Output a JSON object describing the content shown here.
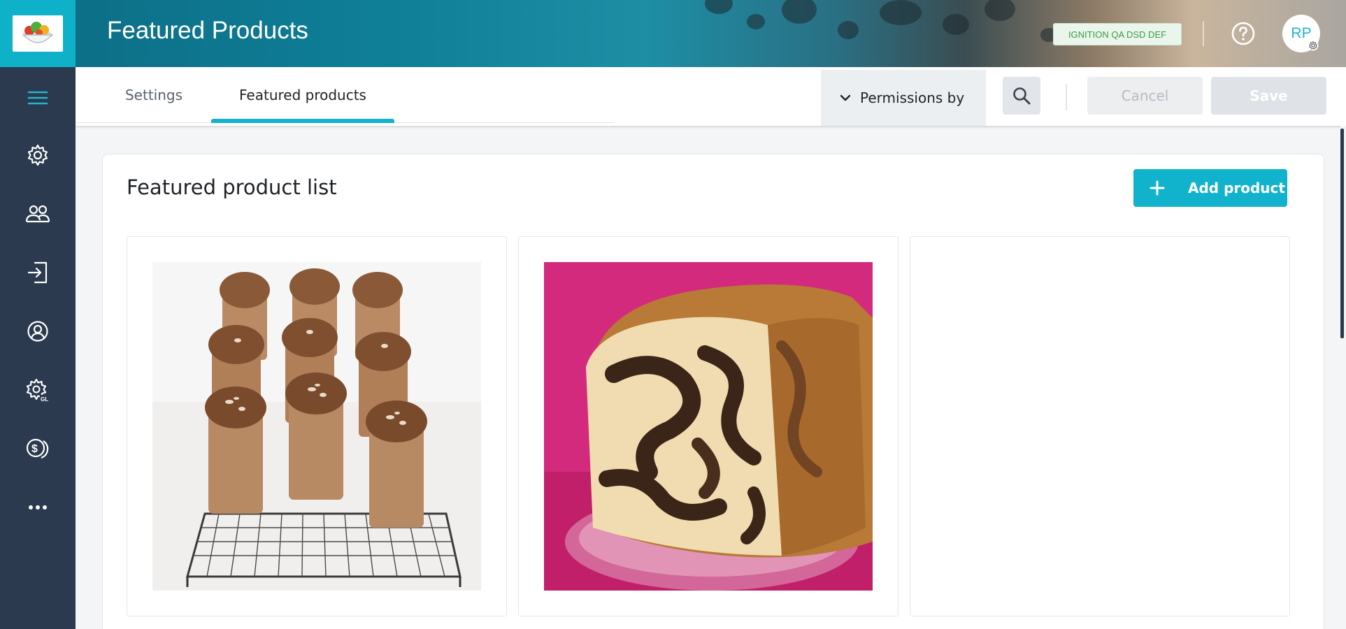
{
  "header": {
    "title": "Featured Products",
    "environment_badge": "IGNITION QA DSD DEF",
    "avatar_initials": "RP",
    "icons": [
      "help-icon",
      "avatar-settings-icon"
    ]
  },
  "sidebar": {
    "logo": "salad-bowl-logo",
    "items": [
      {
        "icon": "menu-icon"
      },
      {
        "icon": "gear-icon"
      },
      {
        "icon": "users-icon"
      },
      {
        "icon": "login-icon"
      },
      {
        "icon": "user-circle-icon"
      },
      {
        "icon": "gear-gl-icon"
      },
      {
        "icon": "coins-icon"
      },
      {
        "icon": "more-icon"
      }
    ]
  },
  "tabs": [
    {
      "label": "Settings",
      "active": false
    },
    {
      "label": "Featured products",
      "active": true
    }
  ],
  "toolbar": {
    "permissions_label": "Permissions by",
    "cancel_label": "Cancel",
    "save_label": "Save"
  },
  "main": {
    "section_title": "Featured product list",
    "add_button_label": "Add product",
    "products": [
      {
        "image": "muffins-on-cooling-rack"
      },
      {
        "image": "marble-cake-slice"
      },
      {
        "image": ""
      }
    ]
  },
  "colors": {
    "sidebar": "#2b3a4e",
    "accent": "#11b3cc",
    "badge_text": "#3a9a4a"
  }
}
